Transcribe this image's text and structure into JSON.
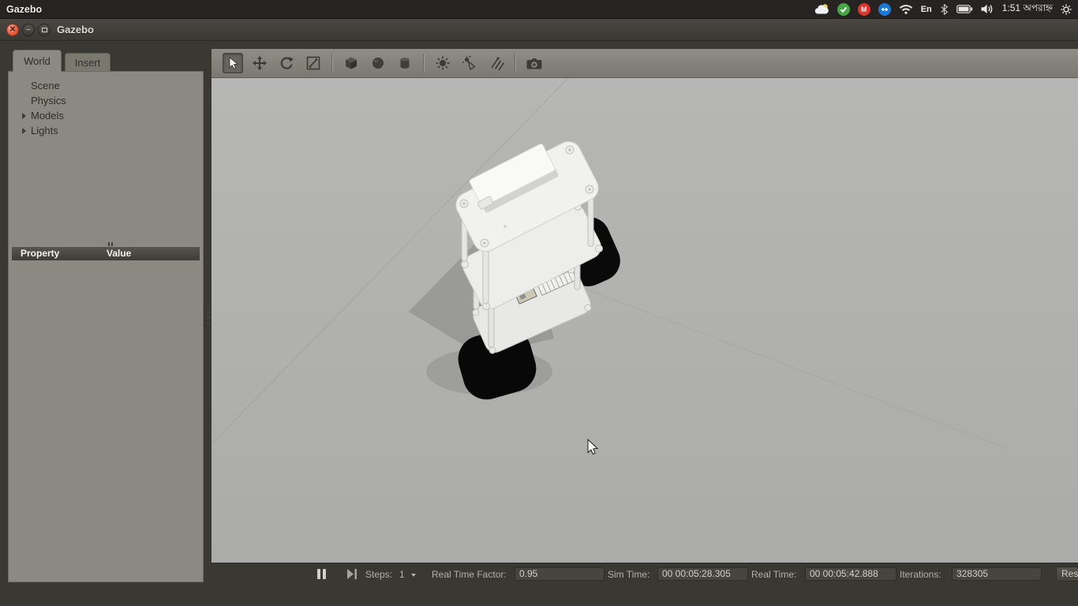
{
  "colors": {
    "window_bg": "#3a3833",
    "panel_bg": "#8c8982",
    "viewport_bg": "#b2b2b0",
    "statusbar_field_bg": "#48453e",
    "close_button": "#e25b3e",
    "tray_green": "#46a546",
    "tray_red": "#dd352e",
    "tray_blue": "#1b78d6"
  },
  "system_bar": {
    "app_name": "Gazebo",
    "tray": {
      "gmail_letter": "M",
      "language_indicator": "En",
      "clock": "1:51 অপরাহ্ন"
    },
    "icons": [
      "weather-cloud",
      "sync-check-circle",
      "gmail-badge",
      "teamviewer-badge",
      "wifi",
      "keyboard-layout",
      "bluetooth",
      "battery",
      "volume",
      "session-gear"
    ]
  },
  "window": {
    "title": "Gazebo",
    "close_glyph": "✕",
    "minimize_glyph": "–"
  },
  "sidebar": {
    "tabs": [
      {
        "label": "World",
        "active": true
      },
      {
        "label": "Insert",
        "active": false
      }
    ],
    "tree": [
      {
        "label": "Scene",
        "expandable": false
      },
      {
        "label": "Physics",
        "expandable": false
      },
      {
        "label": "Models",
        "expandable": true
      },
      {
        "label": "Lights",
        "expandable": true
      }
    ],
    "property_table": {
      "property_header": "Property",
      "value_header": "Value"
    }
  },
  "toolbar": {
    "tools": [
      "select",
      "translate",
      "rotate",
      "scale",
      "box",
      "sphere",
      "cylinder",
      "point-light",
      "spot-light",
      "directional-light",
      "screenshot"
    ]
  },
  "statusbar": {
    "steps_label": "Steps:",
    "steps_value": "1",
    "real_time_factor_label": "Real Time Factor:",
    "real_time_factor_value": "0.95",
    "sim_time_label": "Sim Time:",
    "sim_time_value": "00 00:05:28.305",
    "real_time_label": "Real Time:",
    "real_time_value": "00 00:05:42.888",
    "iterations_label": "Iterations:",
    "iterations_value": "328305",
    "reset_button_label": "Res"
  }
}
